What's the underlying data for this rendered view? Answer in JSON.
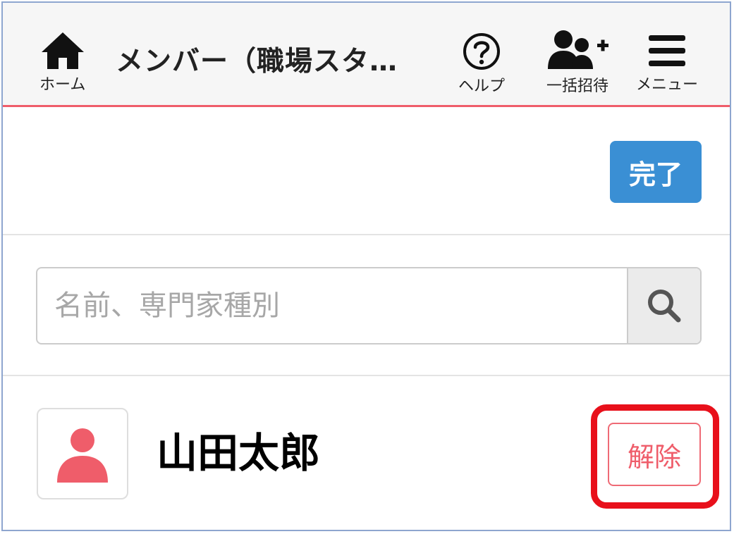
{
  "header": {
    "title": "メンバー（職場スタ…",
    "home_label": "ホーム",
    "help_label": "ヘルプ",
    "bulk_invite_label": "一括招待",
    "menu_label": "メニュー",
    "accent_color": "#ef5d6a"
  },
  "toolbar": {
    "done_label": "完了",
    "done_color": "#3a8fd4"
  },
  "search": {
    "placeholder": "名前、専門家種別",
    "value": ""
  },
  "members": [
    {
      "name": "山田太郎",
      "release_label": "解除",
      "avatar_icon": "user-icon",
      "avatar_color": "#ef5d6a"
    }
  ],
  "annotation": {
    "highlight_color": "#e8101b"
  },
  "icons": {
    "home": "home-icon",
    "help": "question-circle-icon",
    "bulk_invite": "users-plus-icon",
    "menu": "hamburger-icon",
    "search": "search-icon"
  }
}
